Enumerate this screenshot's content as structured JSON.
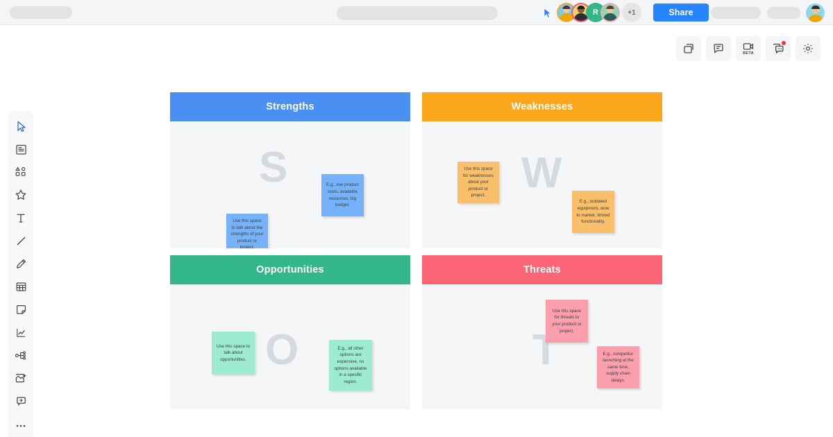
{
  "header": {
    "share_label": "Share",
    "collaborator_count_badge": "+1",
    "avatar_initial": "R",
    "cursor_icon": "pointer-cursor-icon",
    "skeleton_left": "",
    "skeleton_mid": "",
    "skeleton_right_1": "",
    "skeleton_right_2": ""
  },
  "top_toolbar": {
    "items": [
      {
        "name": "frames-icon",
        "label": ""
      },
      {
        "name": "comment-icon",
        "label": ""
      },
      {
        "name": "video-call-icon",
        "label": "BETA"
      },
      {
        "name": "chat-icon",
        "label": ""
      },
      {
        "name": "gear-icon",
        "label": ""
      }
    ]
  },
  "left_toolbar": {
    "items": [
      {
        "name": "select-cursor-icon"
      },
      {
        "name": "template-icon"
      },
      {
        "name": "shapes-icon"
      },
      {
        "name": "star-icon"
      },
      {
        "name": "text-icon"
      },
      {
        "name": "line-icon"
      },
      {
        "name": "pen-icon"
      },
      {
        "name": "table-icon"
      },
      {
        "name": "sticky-note-icon"
      },
      {
        "name": "chart-icon"
      },
      {
        "name": "mindmap-icon"
      },
      {
        "name": "image-icon"
      },
      {
        "name": "comment-add-icon"
      },
      {
        "name": "more-icon"
      }
    ]
  },
  "colors": {
    "strengths": "#4a90f2",
    "weaknesses": "#fba71b",
    "opportunities": "#33b68a",
    "threats": "#fb6576",
    "note_strengths": "#76b2f7",
    "note_weaknesses": "#f9bf6a",
    "note_opportunities": "#9debd0",
    "note_threats": "#fb9fad",
    "quadrant_bg": "#f5f6f7",
    "watermark": "#d6d9dd",
    "accent": "#2684ff"
  },
  "board": {
    "quadrants": [
      {
        "title": "Strengths",
        "watermark": "S",
        "notes": [
          {
            "text": "Use this space to talk about the strengths of your product or project."
          },
          {
            "text": "E.g., low product costs, available resources, big budget."
          }
        ]
      },
      {
        "title": "Weaknesses",
        "watermark": "W",
        "notes": [
          {
            "text": "Use this space for weaknesses about your product or project."
          },
          {
            "text": "E.g., outdated equipment, slow to market, limited functionality."
          }
        ]
      },
      {
        "title": "Opportunities",
        "watermark": "O",
        "notes": [
          {
            "text": "Use this space to talk about opportunities."
          },
          {
            "text": "E.g., all other options are expensive, no options available in a specific region."
          }
        ]
      },
      {
        "title": "Threats",
        "watermark": "T",
        "notes": [
          {
            "text": "Use this space for threats to your product or project."
          },
          {
            "text": "E.g., competitor launching at the same time, supply chain delays."
          }
        ]
      }
    ]
  }
}
